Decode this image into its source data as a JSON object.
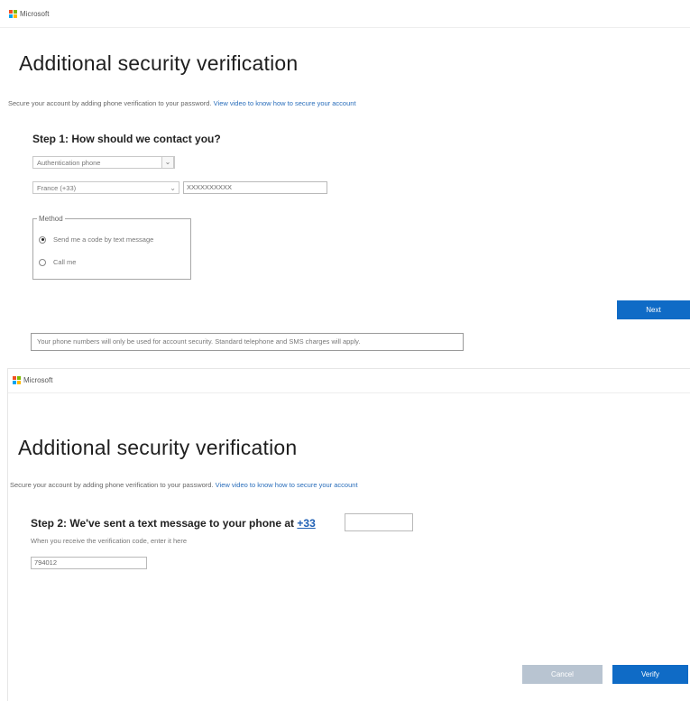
{
  "brand": {
    "name": "Microsoft",
    "logo_colors": [
      "#f25022",
      "#7fba00",
      "#00a4ef",
      "#ffb900"
    ],
    "accent": "#0f6bc6"
  },
  "screen1": {
    "title": "Additional security verification",
    "intro_text": "Secure your account by adding phone verification to your password.",
    "intro_link": "View video to know how to secure your account",
    "step_title": "Step 1: How should we contact you?",
    "contact_type": "Authentication phone",
    "country": "France (+33)",
    "phone_number": "XXXXXXXXXX",
    "method_legend": "Method",
    "method_options": [
      "Send me a code by text message",
      "Call me"
    ],
    "selected_method": "Send me a code by text message",
    "next_label": "Next",
    "notice": "Your phone numbers will only be used for account security. Standard telephone and SMS charges will apply."
  },
  "screen2": {
    "title": "Additional security verification",
    "intro_text": "Secure your account by adding phone verification to your password.",
    "intro_link": "View video to know how to secure your account",
    "step_title": "Step 2: We've sent a text message to your phone at",
    "country_code": "+33",
    "phone_value": "",
    "hint": "When you receive the verification code, enter it here",
    "code_value": "794012",
    "cancel_label": "Cancel",
    "verify_label": "Verify"
  }
}
